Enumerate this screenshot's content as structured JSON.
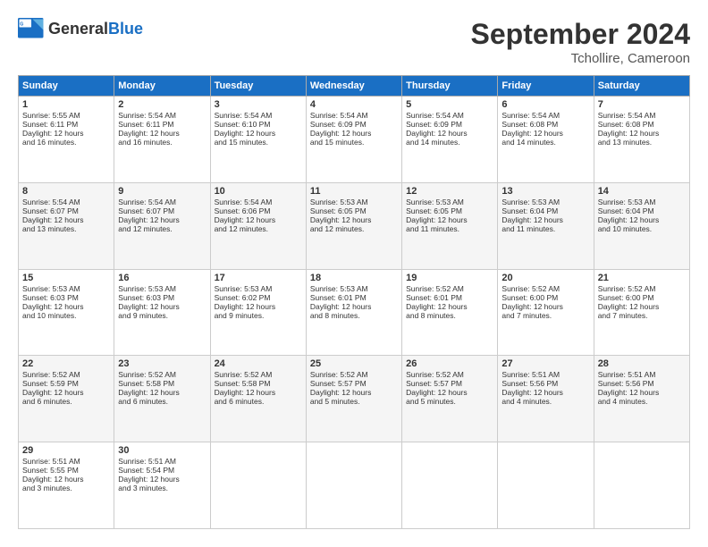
{
  "header": {
    "logo_general": "General",
    "logo_blue": "Blue",
    "month_title": "September 2024",
    "location": "Tchollire, Cameroon"
  },
  "days_of_week": [
    "Sunday",
    "Monday",
    "Tuesday",
    "Wednesday",
    "Thursday",
    "Friday",
    "Saturday"
  ],
  "weeks": [
    [
      {
        "day": "1",
        "lines": [
          "Sunrise: 5:55 AM",
          "Sunset: 6:11 PM",
          "Daylight: 12 hours",
          "and 16 minutes."
        ]
      },
      {
        "day": "2",
        "lines": [
          "Sunrise: 5:54 AM",
          "Sunset: 6:11 PM",
          "Daylight: 12 hours",
          "and 16 minutes."
        ]
      },
      {
        "day": "3",
        "lines": [
          "Sunrise: 5:54 AM",
          "Sunset: 6:10 PM",
          "Daylight: 12 hours",
          "and 15 minutes."
        ]
      },
      {
        "day": "4",
        "lines": [
          "Sunrise: 5:54 AM",
          "Sunset: 6:09 PM",
          "Daylight: 12 hours",
          "and 15 minutes."
        ]
      },
      {
        "day": "5",
        "lines": [
          "Sunrise: 5:54 AM",
          "Sunset: 6:09 PM",
          "Daylight: 12 hours",
          "and 14 minutes."
        ]
      },
      {
        "day": "6",
        "lines": [
          "Sunrise: 5:54 AM",
          "Sunset: 6:08 PM",
          "Daylight: 12 hours",
          "and 14 minutes."
        ]
      },
      {
        "day": "7",
        "lines": [
          "Sunrise: 5:54 AM",
          "Sunset: 6:08 PM",
          "Daylight: 12 hours",
          "and 13 minutes."
        ]
      }
    ],
    [
      {
        "day": "8",
        "lines": [
          "Sunrise: 5:54 AM",
          "Sunset: 6:07 PM",
          "Daylight: 12 hours",
          "and 13 minutes."
        ]
      },
      {
        "day": "9",
        "lines": [
          "Sunrise: 5:54 AM",
          "Sunset: 6:07 PM",
          "Daylight: 12 hours",
          "and 12 minutes."
        ]
      },
      {
        "day": "10",
        "lines": [
          "Sunrise: 5:54 AM",
          "Sunset: 6:06 PM",
          "Daylight: 12 hours",
          "and 12 minutes."
        ]
      },
      {
        "day": "11",
        "lines": [
          "Sunrise: 5:53 AM",
          "Sunset: 6:05 PM",
          "Daylight: 12 hours",
          "and 12 minutes."
        ]
      },
      {
        "day": "12",
        "lines": [
          "Sunrise: 5:53 AM",
          "Sunset: 6:05 PM",
          "Daylight: 12 hours",
          "and 11 minutes."
        ]
      },
      {
        "day": "13",
        "lines": [
          "Sunrise: 5:53 AM",
          "Sunset: 6:04 PM",
          "Daylight: 12 hours",
          "and 11 minutes."
        ]
      },
      {
        "day": "14",
        "lines": [
          "Sunrise: 5:53 AM",
          "Sunset: 6:04 PM",
          "Daylight: 12 hours",
          "and 10 minutes."
        ]
      }
    ],
    [
      {
        "day": "15",
        "lines": [
          "Sunrise: 5:53 AM",
          "Sunset: 6:03 PM",
          "Daylight: 12 hours",
          "and 10 minutes."
        ]
      },
      {
        "day": "16",
        "lines": [
          "Sunrise: 5:53 AM",
          "Sunset: 6:03 PM",
          "Daylight: 12 hours",
          "and 9 minutes."
        ]
      },
      {
        "day": "17",
        "lines": [
          "Sunrise: 5:53 AM",
          "Sunset: 6:02 PM",
          "Daylight: 12 hours",
          "and 9 minutes."
        ]
      },
      {
        "day": "18",
        "lines": [
          "Sunrise: 5:53 AM",
          "Sunset: 6:01 PM",
          "Daylight: 12 hours",
          "and 8 minutes."
        ]
      },
      {
        "day": "19",
        "lines": [
          "Sunrise: 5:52 AM",
          "Sunset: 6:01 PM",
          "Daylight: 12 hours",
          "and 8 minutes."
        ]
      },
      {
        "day": "20",
        "lines": [
          "Sunrise: 5:52 AM",
          "Sunset: 6:00 PM",
          "Daylight: 12 hours",
          "and 7 minutes."
        ]
      },
      {
        "day": "21",
        "lines": [
          "Sunrise: 5:52 AM",
          "Sunset: 6:00 PM",
          "Daylight: 12 hours",
          "and 7 minutes."
        ]
      }
    ],
    [
      {
        "day": "22",
        "lines": [
          "Sunrise: 5:52 AM",
          "Sunset: 5:59 PM",
          "Daylight: 12 hours",
          "and 6 minutes."
        ]
      },
      {
        "day": "23",
        "lines": [
          "Sunrise: 5:52 AM",
          "Sunset: 5:58 PM",
          "Daylight: 12 hours",
          "and 6 minutes."
        ]
      },
      {
        "day": "24",
        "lines": [
          "Sunrise: 5:52 AM",
          "Sunset: 5:58 PM",
          "Daylight: 12 hours",
          "and 6 minutes."
        ]
      },
      {
        "day": "25",
        "lines": [
          "Sunrise: 5:52 AM",
          "Sunset: 5:57 PM",
          "Daylight: 12 hours",
          "and 5 minutes."
        ]
      },
      {
        "day": "26",
        "lines": [
          "Sunrise: 5:52 AM",
          "Sunset: 5:57 PM",
          "Daylight: 12 hours",
          "and 5 minutes."
        ]
      },
      {
        "day": "27",
        "lines": [
          "Sunrise: 5:51 AM",
          "Sunset: 5:56 PM",
          "Daylight: 12 hours",
          "and 4 minutes."
        ]
      },
      {
        "day": "28",
        "lines": [
          "Sunrise: 5:51 AM",
          "Sunset: 5:56 PM",
          "Daylight: 12 hours",
          "and 4 minutes."
        ]
      }
    ],
    [
      {
        "day": "29",
        "lines": [
          "Sunrise: 5:51 AM",
          "Sunset: 5:55 PM",
          "Daylight: 12 hours",
          "and 3 minutes."
        ]
      },
      {
        "day": "30",
        "lines": [
          "Sunrise: 5:51 AM",
          "Sunset: 5:54 PM",
          "Daylight: 12 hours",
          "and 3 minutes."
        ]
      },
      {
        "day": "",
        "lines": []
      },
      {
        "day": "",
        "lines": []
      },
      {
        "day": "",
        "lines": []
      },
      {
        "day": "",
        "lines": []
      },
      {
        "day": "",
        "lines": []
      }
    ]
  ]
}
